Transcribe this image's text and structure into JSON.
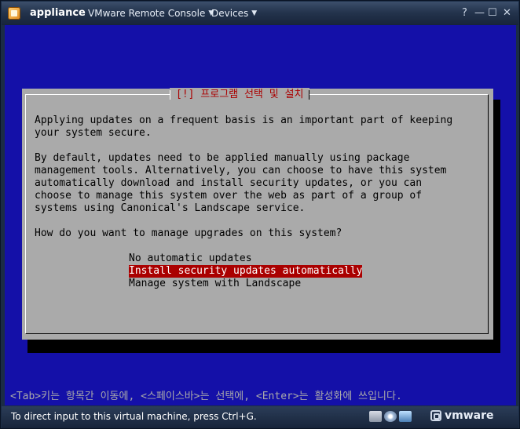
{
  "window": {
    "app_name": "appliance",
    "menus": [
      {
        "label": "VMware Remote Console"
      },
      {
        "label": "Devices"
      }
    ],
    "controls": {
      "help": "?",
      "minimize": "—",
      "maximize": "☐",
      "close": "✕"
    }
  },
  "dialog": {
    "title": "[!] 프로그램 선택 및 설치",
    "paragraphs": [
      "Applying updates on a frequent basis is an important part of keeping\nyour system secure.",
      "By default, updates need to be applied manually using package\nmanagement tools. Alternatively, you can choose to have this system\nautomatically download and install security updates, or you can\nchoose to manage this system over the web as part of a group of\nsystems using Canonical's Landscape service.",
      "How do you want to manage upgrades on this system?"
    ],
    "options": [
      {
        "label": "No automatic updates",
        "selected": false
      },
      {
        "label": "Install security updates automatically",
        "selected": true
      },
      {
        "label": "Manage system with Landscape",
        "selected": false
      }
    ]
  },
  "hint": "<Tab>키는 항목간 이동에, <스페이스바>는 선택에, <Enter>는 활성화에 쓰입니다.",
  "status": {
    "text": "To direct input to this virtual machine, press Ctrl+G.",
    "brand": "vmware"
  },
  "colors": {
    "console_bg": "#1410a8",
    "dialog_bg": "#aaaaaa",
    "highlight": "#aa0000",
    "title_text": "#aa0000"
  },
  "icons": [
    "app-icon",
    "help-icon",
    "minimize-icon",
    "maximize-icon",
    "close-icon",
    "hdd-icon",
    "cdrom-icon",
    "network-icon",
    "vmware-logo-icon"
  ]
}
